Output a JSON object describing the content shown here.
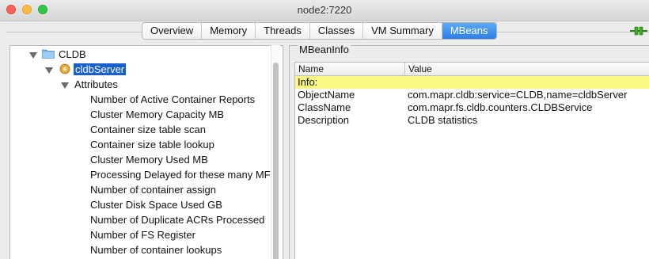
{
  "window": {
    "title": "node2:7220"
  },
  "tabs": [
    {
      "label": "Overview",
      "active": false
    },
    {
      "label": "Memory",
      "active": false
    },
    {
      "label": "Threads",
      "active": false
    },
    {
      "label": "Classes",
      "active": false
    },
    {
      "label": "VM Summary",
      "active": false
    },
    {
      "label": "MBeans",
      "active": true
    }
  ],
  "tree": {
    "root_label": "CLDB",
    "server_label": "cldbServer",
    "attributes_label": "Attributes",
    "attributes": [
      "Number of Active Container Reports",
      "Cluster Memory Capacity MB",
      "Container size table scan",
      "Container size table lookup",
      "Cluster Memory Used MB",
      "Processing Delayed for these many MFS",
      "Number of container assign",
      "Cluster Disk Space Used GB",
      "Number of Duplicate ACRs Processed",
      "Number of FS Register",
      "Number of container lookups"
    ]
  },
  "mbean_info": {
    "group_label": "MBeanInfo",
    "columns": {
      "name": "Name",
      "value": "Value"
    },
    "rows": [
      {
        "name": "Info:",
        "value": "",
        "highlight": true
      },
      {
        "name": "ObjectName",
        "value": "com.mapr.cldb:service=CLDB,name=cldbServer",
        "highlight": false
      },
      {
        "name": "ClassName",
        "value": "com.mapr.fs.cldb.counters.CLDBService",
        "highlight": false
      },
      {
        "name": "Description",
        "value": "CLDB statistics",
        "highlight": false
      }
    ]
  },
  "colors": {
    "selection": "#1660d2",
    "active_tab": "#2b7fe8",
    "highlight_row": "#f8f883"
  },
  "icons": {
    "root": "folder-icon",
    "server": "mbean-icon",
    "connection": "connection-plug-icon"
  }
}
